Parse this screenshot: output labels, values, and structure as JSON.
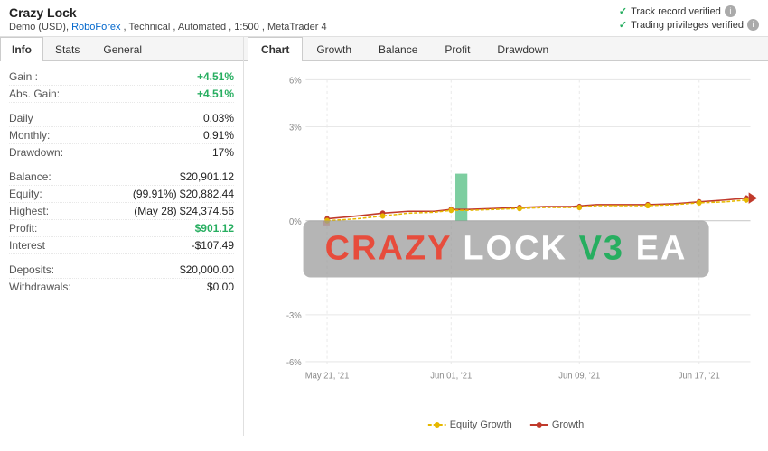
{
  "header": {
    "title": "Crazy Lock",
    "subtitle_parts": [
      "Demo (USD),",
      "RoboForex",
      ", Technical , Automated , 1:500 , MetaTrader 4"
    ],
    "verified": [
      {
        "label": "Track record verified",
        "has_info": true
      },
      {
        "label": "Trading privileges verified",
        "has_info": true
      }
    ]
  },
  "left_tabs": [
    {
      "label": "Info",
      "active": true
    },
    {
      "label": "Stats",
      "active": false
    },
    {
      "label": "General",
      "active": false
    }
  ],
  "info_rows": [
    {
      "label": "Gain :",
      "value": "+4.51%",
      "class": "green"
    },
    {
      "label": "Abs. Gain:",
      "value": "+4.51%",
      "class": "green"
    },
    {
      "separator": true
    },
    {
      "label": "Daily",
      "value": "0.03%",
      "class": ""
    },
    {
      "label": "Monthly:",
      "value": "0.91%",
      "class": ""
    },
    {
      "label": "Drawdown:",
      "value": "17%",
      "class": ""
    },
    {
      "separator": true
    },
    {
      "label": "Balance:",
      "value": "$20,901.12",
      "class": ""
    },
    {
      "label": "Equity:",
      "value": "(99.91%) $20,882.44",
      "class": ""
    },
    {
      "label": "Highest:",
      "value": "(May 28) $24,374.56",
      "class": ""
    },
    {
      "label": "Profit:",
      "value": "$901.12",
      "class": "green"
    },
    {
      "label": "Interest",
      "value": "-$107.49",
      "class": ""
    },
    {
      "separator": true
    },
    {
      "label": "Deposits:",
      "value": "$20,000.00",
      "class": ""
    },
    {
      "label": "Withdrawals:",
      "value": "$0.00",
      "class": ""
    }
  ],
  "chart_tabs": [
    {
      "label": "Chart",
      "active": true
    },
    {
      "label": "Growth",
      "active": false
    },
    {
      "label": "Balance",
      "active": false
    },
    {
      "label": "Profit",
      "active": false
    },
    {
      "label": "Drawdown",
      "active": false
    }
  ],
  "chart": {
    "watermark": {
      "crazy": "CRAZY",
      "lock": " LOCK ",
      "v3": "V3",
      "ea": " EA"
    },
    "y_labels": [
      "6%",
      "3%",
      "0%",
      "-3%",
      "-6%"
    ],
    "x_labels": [
      "May 21, '21",
      "Jun 01, '21",
      "Jun 09, '21",
      "Jun 17, '21"
    ],
    "legend": [
      {
        "label": "Equity Growth",
        "color": "#e6b800",
        "type": "dashed"
      },
      {
        "label": "Growth",
        "color": "#c0392b",
        "type": "solid"
      }
    ]
  }
}
